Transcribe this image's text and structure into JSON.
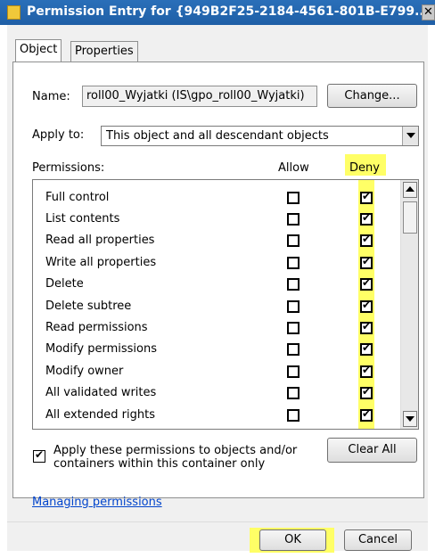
{
  "window": {
    "title": "Permission Entry for {949B2F25-2184-4561-801B-E799..."
  },
  "tabs": [
    {
      "label": "Object"
    },
    {
      "label": "Properties"
    }
  ],
  "name": {
    "label": "Name:",
    "value": "roll00_Wyjatki (IS\\gpo_roll00_Wyjatki)",
    "change_button": "Change..."
  },
  "apply_to": {
    "label": "Apply to:",
    "value": "This object and all descendant objects"
  },
  "permissions": {
    "header": "Permissions:",
    "allow_header": "Allow",
    "deny_header": "Deny",
    "items": [
      {
        "label": "Full control",
        "allow": false,
        "deny": true
      },
      {
        "label": "List contents",
        "allow": false,
        "deny": true
      },
      {
        "label": "Read all properties",
        "allow": false,
        "deny": true
      },
      {
        "label": "Write all properties",
        "allow": false,
        "deny": true
      },
      {
        "label": "Delete",
        "allow": false,
        "deny": true
      },
      {
        "label": "Delete subtree",
        "allow": false,
        "deny": true
      },
      {
        "label": "Read permissions",
        "allow": false,
        "deny": true
      },
      {
        "label": "Modify permissions",
        "allow": false,
        "deny": true
      },
      {
        "label": "Modify owner",
        "allow": false,
        "deny": true
      },
      {
        "label": "All validated writes",
        "allow": false,
        "deny": true
      },
      {
        "label": "All extended rights",
        "allow": false,
        "deny": true
      }
    ]
  },
  "apply_checkbox": {
    "label": "Apply these permissions to objects and/or containers within this container only",
    "checked": true
  },
  "clear_all_button": "Clear All",
  "managing_link": "Managing permissions",
  "ok_button": "OK",
  "cancel_button": "Cancel",
  "colors": {
    "title_bar": "#1f5fa6",
    "highlight": "#ffff66",
    "link": "#0044cc"
  }
}
